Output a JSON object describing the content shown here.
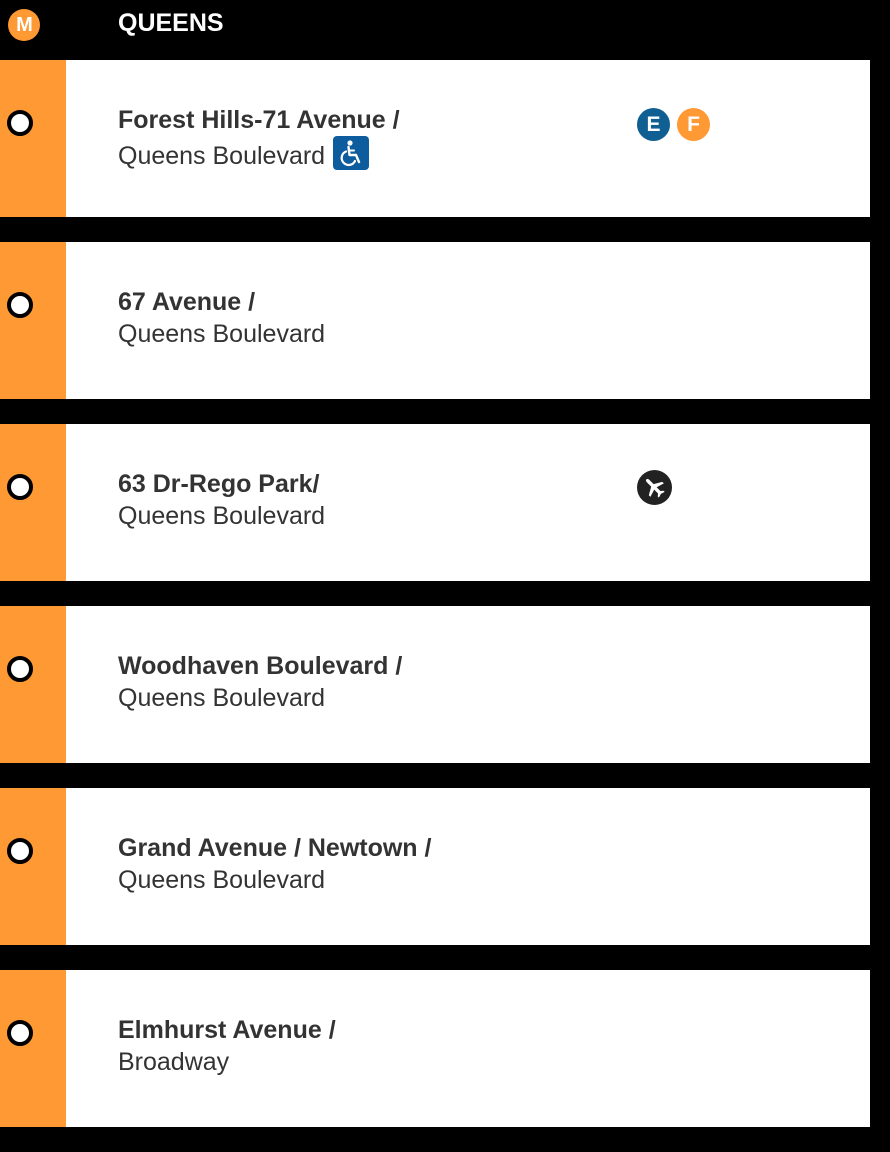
{
  "header": {
    "line_badge": "M",
    "borough": "QUEENS"
  },
  "colors": {
    "line_orange": "#ff9933",
    "e_train_blue": "#0f5f93",
    "accessible_blue": "#0d5c9e"
  },
  "stations": [
    {
      "name": "Forest Hills-71 Avenue /",
      "street": "Queens Boulevard",
      "accessible": true,
      "accessible_icon": "wheelchair-icon",
      "transfers": [
        {
          "label": "E",
          "color": "#0f5f93"
        },
        {
          "label": "F",
          "color": "#ff9933"
        }
      ]
    },
    {
      "name": "67 Avenue /",
      "street": "Queens Boulevard"
    },
    {
      "name": "63 Dr-Rego Park/",
      "street": "Queens Boulevard",
      "airport_icon": "airplane-icon"
    },
    {
      "name": "Woodhaven Boulevard /",
      "street": "Queens Boulevard"
    },
    {
      "name": "Grand Avenue / Newtown /",
      "street": "Queens Boulevard"
    },
    {
      "name": "Elmhurst Avenue /",
      "street": "Broadway"
    }
  ]
}
